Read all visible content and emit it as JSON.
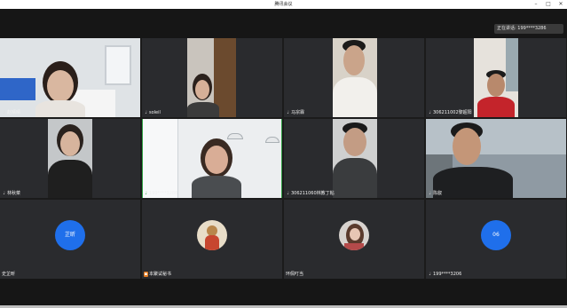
{
  "window": {
    "title": "腾讯会议"
  },
  "speaking": {
    "label": "正在讲话: 199****3286"
  },
  "participants": [
    {
      "name": "赵晴晴"
    },
    {
      "name": "soleil"
    },
    {
      "name": "马宗霖"
    },
    {
      "name": "306211002黎超阳"
    },
    {
      "name": "林秋菜"
    },
    {
      "name": "199****3286"
    },
    {
      "name": "306211060林教丁粘"
    },
    {
      "name": "陈叡"
    },
    {
      "name": "史芷昕",
      "avatar_text": "芷昕"
    },
    {
      "name": "本聚试秘书"
    },
    {
      "name": "环佩叮当"
    },
    {
      "name": "199****3206",
      "avatar_text": "06"
    }
  ],
  "colors": {
    "avatar_blue": "#1f6feb",
    "active_border": "#2ea043"
  }
}
